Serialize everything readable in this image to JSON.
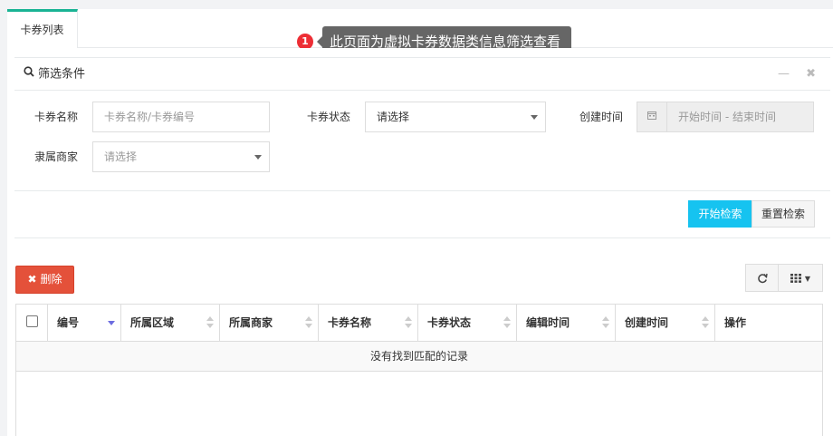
{
  "tabs": [
    {
      "label": "卡券列表"
    }
  ],
  "tooltip": {
    "badge": "1",
    "text": "此页面为虚拟卡券数据类信息筛选查看"
  },
  "filter": {
    "title": "筛选条件",
    "fields": {
      "card_name": {
        "label": "卡券名称",
        "placeholder": "卡券名称/卡券编号"
      },
      "card_status": {
        "label": "卡券状态",
        "value": "请选择"
      },
      "created_time": {
        "label": "创建时间",
        "placeholder": "开始时间 - 结束时间"
      },
      "merchant": {
        "label": "隶属商家",
        "value": "请选择"
      }
    },
    "search_button": "开始检索",
    "reset_button": "重置检索"
  },
  "toolbar": {
    "delete_label": "删除"
  },
  "table": {
    "columns": [
      "编号",
      "所属区域",
      "所属商家",
      "卡券名称",
      "卡券状态",
      "编辑时间",
      "创建时间",
      "操作"
    ],
    "empty_text": "没有找到匹配的记录"
  },
  "colors": {
    "accent": "#1ab394",
    "primary": "#16c3f0",
    "danger": "#e4513a",
    "badge": "#ed2e35",
    "tooltip_bg": "#666666"
  }
}
